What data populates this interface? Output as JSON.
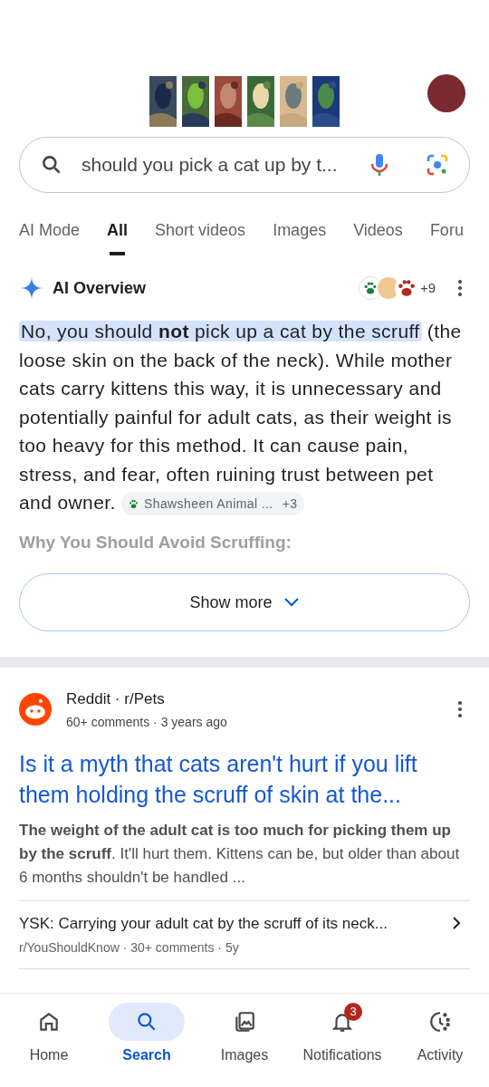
{
  "search": {
    "value": "should you pick a cat up by t..."
  },
  "tabs": [
    {
      "label": "AI Mode",
      "selected": false
    },
    {
      "label": "All",
      "selected": true
    },
    {
      "label": "Short videos",
      "selected": false
    },
    {
      "label": "Images",
      "selected": false
    },
    {
      "label": "Videos",
      "selected": false
    },
    {
      "label": "Foru",
      "selected": false
    }
  ],
  "ai_overview": {
    "title": "AI Overview",
    "sources_count": "+9",
    "highlight": "No, you should **not** pick up a cat by the scruff",
    "text": "(the loose skin on the back of the neck). While mother cats carry kittens this way, it is unnecessary and potentially painful for adult cats, as their weight is too heavy for this method. It can cause pain, stress, and fear, often ruining trust between pet and owner.",
    "citation": {
      "label": "Shawsheen Animal ...",
      "count": "+3"
    },
    "faded_heading": "Why You Should Avoid Scruffing:",
    "show_more": "Show more"
  },
  "result": {
    "site": "Reddit · r/Pets",
    "meta": "60+ comments · 3 years ago",
    "title": "Is it a myth that cats aren't hurt if you lift them holding the scruff of skin at the...",
    "snippet": "**The weight of the adult cat is too much for picking them up by the scruff**. It'll hurt them. Kittens can be, but older than about 6 months shouldn't be handled ...",
    "related": [
      {
        "title": "YSK: Carrying your adult cat by the scruff of its neck...",
        "meta": "r/YouShouldKnow · 30+ comments · 5y"
      }
    ]
  },
  "nav": [
    {
      "label": "Home",
      "kind": "home",
      "selected": false
    },
    {
      "label": "Search",
      "kind": "search",
      "selected": true
    },
    {
      "label": "Images",
      "kind": "images",
      "selected": false
    },
    {
      "label": "Notifications",
      "kind": "bell",
      "selected": false,
      "badge": "3"
    },
    {
      "label": "Activity",
      "kind": "activity",
      "selected": false
    }
  ]
}
